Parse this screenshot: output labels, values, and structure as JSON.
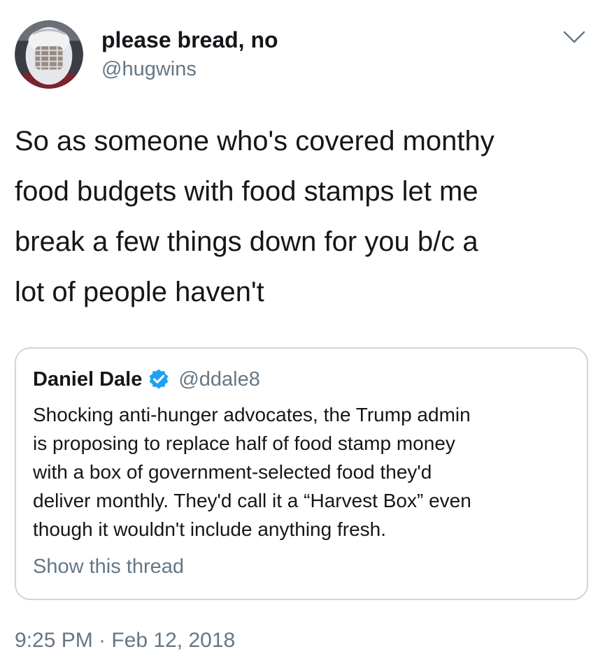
{
  "tweet": {
    "avatar_icon": "goalie-mask-avatar",
    "display_name": "please bread, no",
    "handle": "@hugwins",
    "menu_icon": "chevron-down-icon",
    "text": "So as someone who's covered monthy\nfood budgets with food stamps let me\nbreak a few things down for you b/c a\nlot of people haven't",
    "timestamp": "9:25 PM · Feb 12, 2018"
  },
  "quote": {
    "name": "Daniel Dale",
    "verified_icon": "verified-badge-icon",
    "handle": "@ddale8",
    "text": "Shocking anti-hunger advocates, the Trump admin\nis proposing to replace half of food stamp money\nwith a box of government-selected food they'd\ndeliver monthly. They'd call it a “Harvest Box” even\nthough it wouldn't include anything fresh.",
    "show_thread_label": "Show this thread"
  },
  "colors": {
    "text_primary": "#14171a",
    "text_secondary": "#657786",
    "border": "#ccd6dd",
    "verified_blue": "#1da1f2"
  }
}
